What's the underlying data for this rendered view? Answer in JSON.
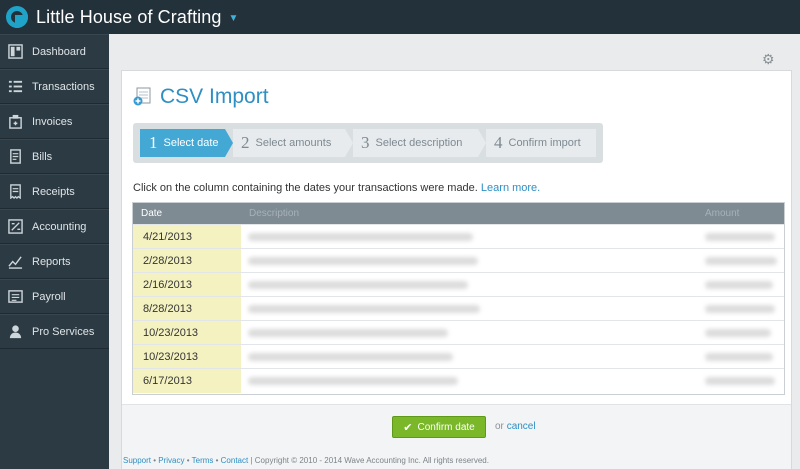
{
  "header": {
    "business_name": "Little House of Crafting"
  },
  "sidebar": {
    "items": [
      {
        "label": "Dashboard",
        "icon": "dashboard-icon"
      },
      {
        "label": "Transactions",
        "icon": "transactions-icon"
      },
      {
        "label": "Invoices",
        "icon": "invoices-icon"
      },
      {
        "label": "Bills",
        "icon": "bills-icon"
      },
      {
        "label": "Receipts",
        "icon": "receipts-icon"
      },
      {
        "label": "Accounting",
        "icon": "accounting-icon"
      },
      {
        "label": "Reports",
        "icon": "reports-icon"
      },
      {
        "label": "Payroll",
        "icon": "payroll-icon"
      },
      {
        "label": "Pro Services",
        "icon": "pro-services-icon"
      }
    ]
  },
  "main": {
    "title": "CSV Import",
    "steps": [
      {
        "num": "1",
        "label": "Select date"
      },
      {
        "num": "2",
        "label": "Select amounts"
      },
      {
        "num": "3",
        "label": "Select description"
      },
      {
        "num": "4",
        "label": "Confirm import"
      }
    ],
    "instructions": "Click on the column containing the dates your transactions were made.",
    "learn_more": "Learn more.",
    "table": {
      "headers": {
        "date": "Date",
        "description": "Description",
        "amount": "Amount"
      },
      "rows": [
        {
          "date": "4/21/2013"
        },
        {
          "date": "2/28/2013"
        },
        {
          "date": "2/16/2013"
        },
        {
          "date": "8/28/2013"
        },
        {
          "date": "10/23/2013"
        },
        {
          "date": "10/23/2013"
        },
        {
          "date": "6/17/2013"
        }
      ]
    },
    "confirm_label": "Confirm date",
    "or_text": "or",
    "cancel_label": "cancel"
  },
  "footer": {
    "support": "Support",
    "privacy": "Privacy",
    "terms": "Terms",
    "contact": "Contact",
    "copyright": "| Copyright © 2010 - 2014 Wave Accounting Inc. All rights reserved."
  },
  "colors": {
    "topbar": "#23313a",
    "sidebar": "#2c3a43",
    "accent": "#2e8fc4",
    "active_step": "#43a8d4",
    "date_column": "#f4f2c1",
    "confirm_button": "#7ab82a"
  }
}
